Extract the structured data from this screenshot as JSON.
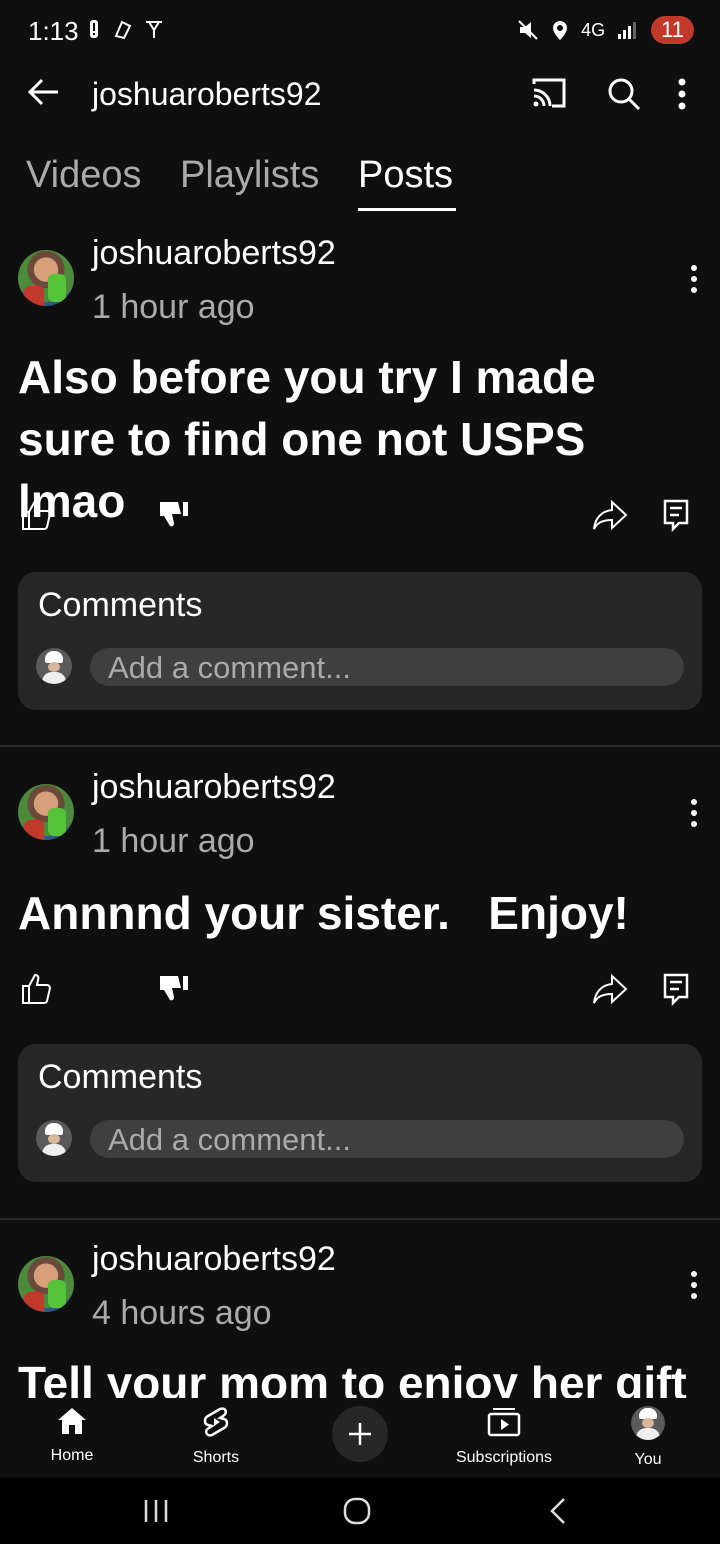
{
  "status": {
    "time": "1:13",
    "network": "4G",
    "battery": "11"
  },
  "topbar": {
    "channel": "joshuaroberts92"
  },
  "tabs": [
    {
      "label": "Videos"
    },
    {
      "label": "Playlists"
    },
    {
      "label": "Posts"
    }
  ],
  "active_tab": "Posts",
  "posts": [
    {
      "author": "joshuaroberts92",
      "time": "1 hour ago",
      "text": "Also before you try I made sure to find one not USPS lmao",
      "comments_title": "Comments",
      "comment_placeholder": "Add a comment..."
    },
    {
      "author": "joshuaroberts92",
      "time": "1 hour ago",
      "text": "Annnnd your sister.   Enjoy!",
      "comments_title": "Comments",
      "comment_placeholder": "Add a comment..."
    },
    {
      "author": "joshuaroberts92",
      "time": "4 hours ago",
      "text": "Tell your mom to enjoy her gift"
    }
  ],
  "bottom_nav": [
    {
      "label": "Home"
    },
    {
      "label": "Shorts"
    },
    {
      "label": "Subscriptions"
    },
    {
      "label": "You"
    }
  ],
  "icons": {
    "back": "arrow-left-icon",
    "cast": "cast-icon",
    "search": "search-icon",
    "more": "more-vert-icon",
    "like": "thumb-up-icon",
    "dislike": "thumb-down-icon",
    "share": "share-icon",
    "comment": "comment-icon"
  },
  "colors": {
    "background": "#0f0f0f",
    "surface": "#272727",
    "secondary_text": "#aaaaaa",
    "battery": "#c0392b"
  }
}
